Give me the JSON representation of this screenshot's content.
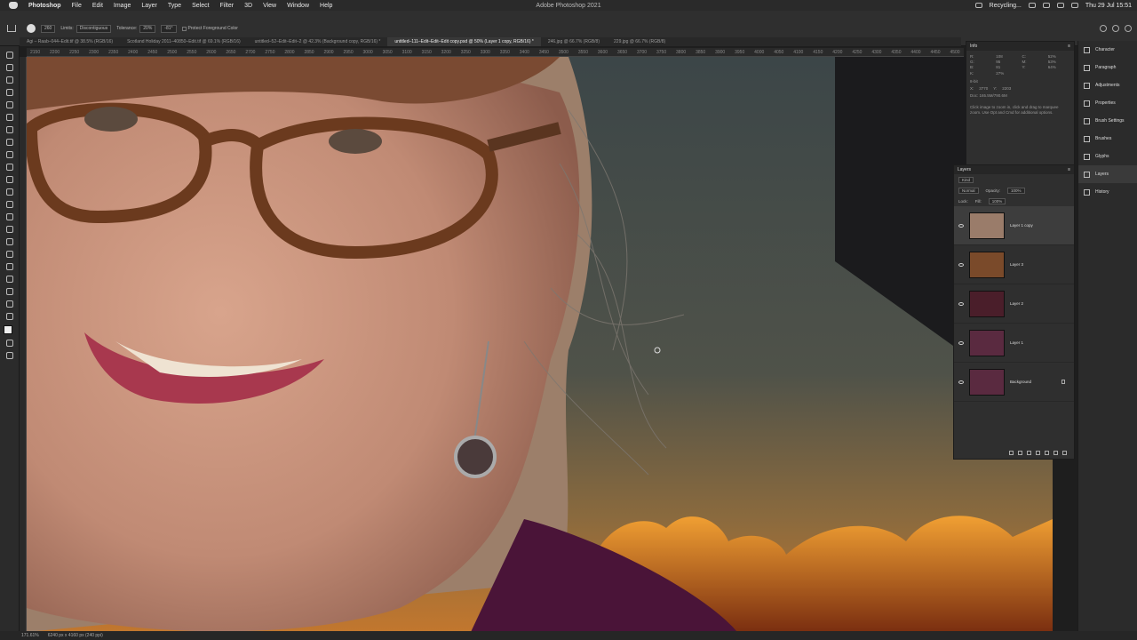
{
  "menubar": {
    "app": "Photoshop",
    "items": [
      "File",
      "Edit",
      "Image",
      "Layer",
      "Type",
      "Select",
      "Filter",
      "3D",
      "View",
      "Window",
      "Help"
    ],
    "title": "Adobe Photoshop 2021",
    "status_app": "Recycling...",
    "datetime": "Thu 29 Jul  15:51"
  },
  "options": {
    "limits_label": "Limits:",
    "limits_value": "Discontiguous",
    "tolerance_label": "Tolerance:",
    "tolerance_value": "20%",
    "angle_value": "-81°",
    "protect_label": "Protect Foreground Color"
  },
  "tabs": [
    "Agi – Raab–044–Edit.tif @ 38.5% (RGB/16)",
    "Scotland Holiday 2011–40850–Edit.tif @ 69.1% (RGB/16)",
    "untitled–52–Edit–Edit–2 @ 42.3% (Background copy, RGB/16) *",
    "untitled–111–Edit–Edit–Edit copy.psd @ 50% (Layer 1 copy, RGB/16) *",
    "246.jpg @ 66.7% (RGB/8)",
    "229.jpg @ 66.7% (RGB/8)"
  ],
  "ruler_ticks": [
    "2150",
    "2200",
    "2250",
    "2300",
    "2350",
    "2400",
    "2450",
    "2500",
    "2550",
    "2600",
    "2650",
    "2700",
    "2750",
    "2800",
    "2850",
    "2900",
    "2950",
    "3000",
    "3050",
    "3100",
    "3150",
    "3200",
    "3250",
    "3300",
    "3350",
    "3400",
    "3450",
    "3500",
    "3550",
    "3600",
    "3650",
    "3700",
    "3750",
    "3800",
    "3850",
    "3900",
    "3950",
    "4000",
    "4050",
    "4100",
    "4150",
    "4200",
    "4250",
    "4300",
    "4350",
    "4400",
    "4450",
    "4500"
  ],
  "info": {
    "title": "Info",
    "rgb": [
      "R:",
      "108",
      "G:",
      "95",
      "B:",
      "81"
    ],
    "cmyk": [
      "C:",
      "52%",
      "M:",
      "53%",
      "Y:",
      "64%",
      "K:",
      "27%"
    ],
    "bit": "8-bit",
    "x": "3770",
    "y": "2203",
    "doc": "Doc: 165.5M/790.6M",
    "help": "Click image to zoom in, click and drag to marquee zoom. Use Opt and Cmd for additional options."
  },
  "layers_panel": {
    "title": "Layers",
    "kind": "Kind",
    "blend": "Normal",
    "opacity_label": "Opacity:",
    "opacity": "100%",
    "lock_label": "Lock:",
    "fill_label": "Fill:",
    "fill": "100%",
    "layers": [
      {
        "name": "Layer 1 copy",
        "selected": true,
        "thumb": "#9a7c6a"
      },
      {
        "name": "Layer 3",
        "selected": false,
        "thumb": "#7a4a2a"
      },
      {
        "name": "Layer 2",
        "selected": false,
        "thumb": "#4a1e2a"
      },
      {
        "name": "Layer 1",
        "selected": false,
        "thumb": "#5a2a40"
      },
      {
        "name": "Background",
        "selected": false,
        "thumb": "#5a2a40"
      }
    ]
  },
  "dock": [
    {
      "label": "Character",
      "active": false
    },
    {
      "label": "Paragraph",
      "active": false
    },
    {
      "label": "Adjustments",
      "active": false
    },
    {
      "label": "Properties",
      "active": false
    },
    {
      "label": "Brush Settings",
      "active": false
    },
    {
      "label": "Brushes",
      "active": false
    },
    {
      "label": "Glyphs",
      "active": false
    },
    {
      "label": "Layers",
      "active": true
    },
    {
      "label": "History",
      "active": false
    }
  ],
  "status": {
    "zoom": "171.61%",
    "doc_size": "6240 px x 4160 px (240 ppi)"
  }
}
